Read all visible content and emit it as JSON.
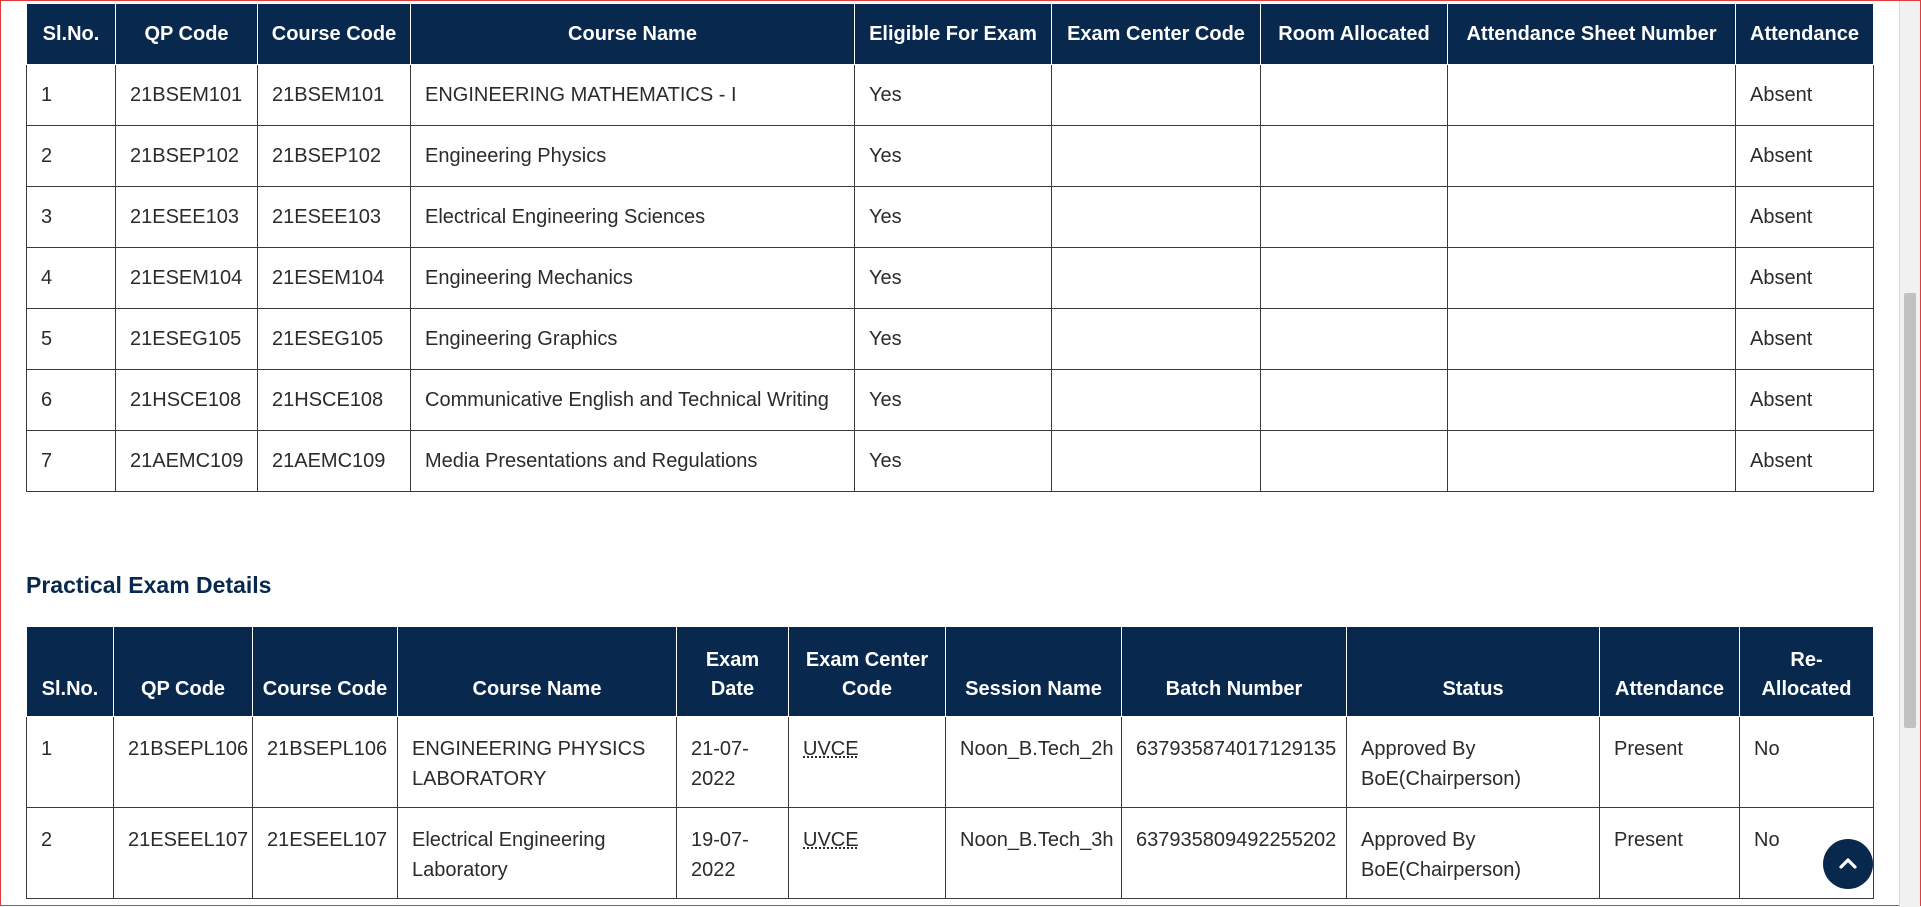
{
  "theory_table": {
    "columns": [
      "Sl.No.",
      "QP Code",
      "Course Code",
      "Course Name",
      "Eligible For Exam",
      "Exam Center Code",
      "Room Allocated",
      "Attendance Sheet Number",
      "Attendance"
    ],
    "rows": [
      [
        "1",
        "21BSEM101",
        "21BSEM101",
        "ENGINEERING MATHEMATICS - I",
        "Yes",
        "",
        "",
        "",
        "Absent"
      ],
      [
        "2",
        "21BSEP102",
        "21BSEP102",
        "Engineering Physics",
        "Yes",
        "",
        "",
        "",
        "Absent"
      ],
      [
        "3",
        "21ESEE103",
        "21ESEE103",
        "Electrical Engineering Sciences",
        "Yes",
        "",
        "",
        "",
        "Absent"
      ],
      [
        "4",
        "21ESEM104",
        "21ESEM104",
        "Engineering Mechanics",
        "Yes",
        "",
        "",
        "",
        "Absent"
      ],
      [
        "5",
        "21ESEG105",
        "21ESEG105",
        "Engineering Graphics",
        "Yes",
        "",
        "",
        "",
        "Absent"
      ],
      [
        "6",
        "21HSCE108",
        "21HSCE108",
        "Communicative English and Technical Writing",
        "Yes",
        "",
        "",
        "",
        "Absent"
      ],
      [
        "7",
        "21AEMC109",
        "21AEMC109",
        "Media Presentations and Regulations",
        "Yes",
        "",
        "",
        "",
        "Absent"
      ]
    ]
  },
  "practical_section": {
    "title": "Practical Exam Details",
    "columns": [
      "Sl.No.",
      "QP Code",
      "Course Code",
      "Course Name",
      "Exam Date",
      "Exam Center Code",
      "Session Name",
      "Batch Number",
      "Status",
      "Attendance",
      "Re-Allocated"
    ],
    "rows": [
      [
        "1",
        "21BSEPL106",
        "21BSEPL106",
        "ENGINEERING PHYSICS LABORATORY",
        "21-07-2022",
        "UVCE",
        "Noon_B.Tech_2h",
        "637935874017129135",
        "Approved By BoE(Chairperson)",
        "Present",
        "No"
      ],
      [
        "2",
        "21ESEEL107",
        "21ESEEL107",
        "Electrical Engineering Laboratory",
        "19-07-2022",
        "UVCE",
        "Noon_B.Tech_3h",
        "637935809492255202",
        "Approved By BoE(Chairperson)",
        "Present",
        "No"
      ]
    ]
  },
  "scroll_top_button": {
    "icon": "chevron-up-icon"
  },
  "colors": {
    "header_bg": "#08284d",
    "header_text": "#ffffff",
    "section_title": "#08284d"
  }
}
